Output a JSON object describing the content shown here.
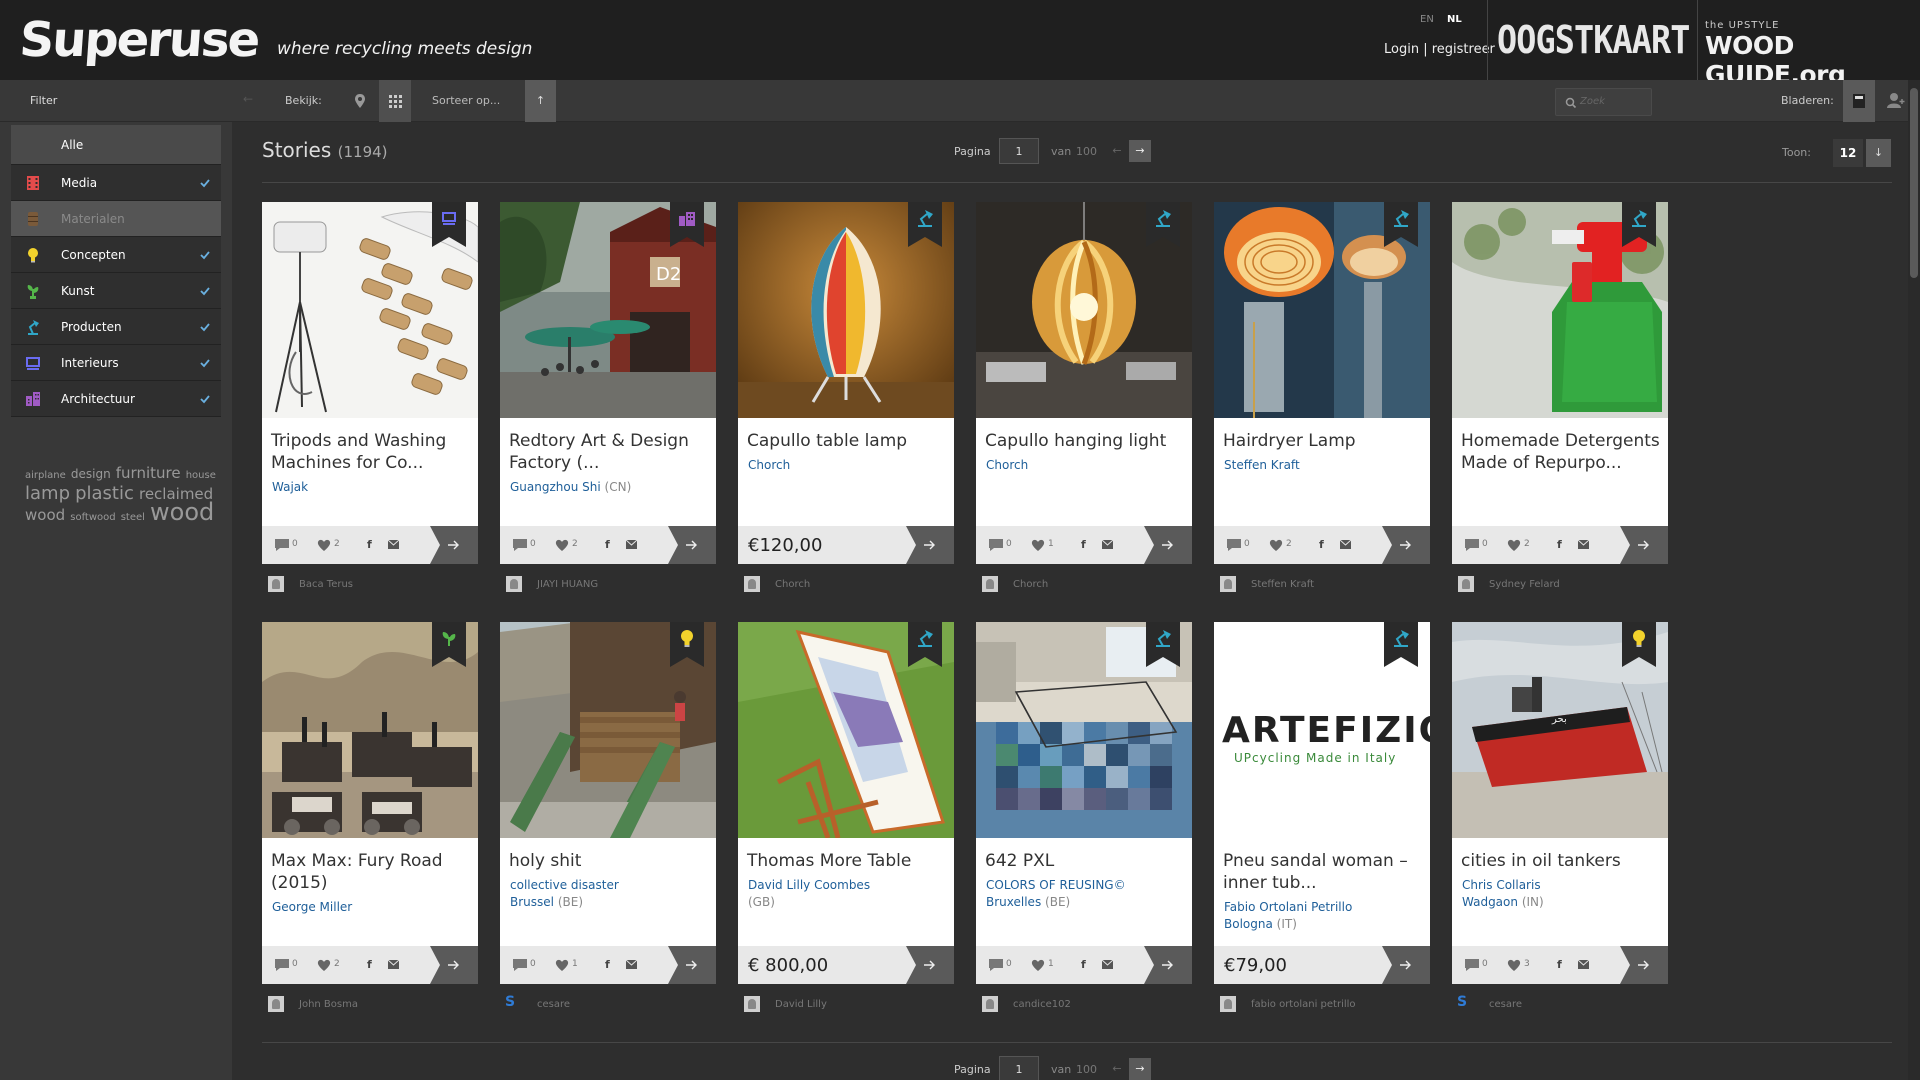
{
  "header": {
    "logo_text": "Superuse",
    "tagline": "where recycling meets design",
    "lang_en": "EN",
    "lang_nl": "NL",
    "login": "Login | registreer",
    "partner1": "OOGSTKAART",
    "partner2_small": "the UPSTYLE",
    "partner2": "WOOD GUIDE.org"
  },
  "toolbar": {
    "filter": "Filter",
    "bekijk": "Bekijk:",
    "sort": "Sorteer op...",
    "search_placeholder": "Zoek",
    "bladeren": "Bladeren:"
  },
  "sidebar": {
    "categories": [
      {
        "label": "Alle",
        "icon": "all",
        "color": "#ffffff",
        "checked": false
      },
      {
        "label": "Media",
        "icon": "film-icon",
        "color": "#e34b4b",
        "checked": true
      },
      {
        "label": "Materialen",
        "icon": "barrel-icon",
        "color": "#7a5a3a",
        "checked": false
      },
      {
        "label": "Concepten",
        "icon": "lightbulb-icon",
        "color": "#f2d22c",
        "checked": true
      },
      {
        "label": "Kunst",
        "icon": "plant-icon",
        "color": "#55b64a",
        "checked": true
      },
      {
        "label": "Producten",
        "icon": "lamp-icon",
        "color": "#30a7c8",
        "checked": true
      },
      {
        "label": "Interieurs",
        "icon": "interior-icon",
        "color": "#6a6cf2",
        "checked": true
      },
      {
        "label": "Architectuur",
        "icon": "building-icon",
        "color": "#a05bc4",
        "checked": true
      }
    ],
    "tags": [
      {
        "t": "airplane",
        "s": "sm"
      },
      {
        "t": "design",
        "s": "md"
      },
      {
        "t": "furniture",
        "s": "lg"
      },
      {
        "t": "house",
        "s": "sm"
      },
      {
        "t": "lamp",
        "s": "xl"
      },
      {
        "t": "plastic",
        "s": "xl"
      },
      {
        "t": "reclaimed",
        "s": "lg"
      },
      {
        "t": "wood",
        "s": "lg"
      },
      {
        "t": "softwood",
        "s": "sm"
      },
      {
        "t": "steel",
        "s": "sm"
      },
      {
        "t": "wood",
        "s": "xxl"
      }
    ]
  },
  "main": {
    "title": "Stories",
    "count": "(1194)",
    "pager": {
      "label": "Pagina",
      "page": "1",
      "van": "van",
      "total": "100"
    },
    "toon_label": "Toon:",
    "toon_value": "12"
  },
  "cards": [
    {
      "title": "Tripods and Washing Machines for Co...",
      "author": "Wajak",
      "loc": "",
      "cc": "",
      "comments": "0",
      "likes": "2",
      "price": "",
      "user": "Baca Terus",
      "avatar": "box",
      "ribbon": "interior",
      "img": "tripod"
    },
    {
      "title": "Redtory Art & Design Factory (...",
      "author": "",
      "loc": "Guangzhou Shi",
      "cc": "(CN)",
      "comments": "0",
      "likes": "2",
      "price": "",
      "user": "JIAYI HUANG",
      "avatar": "box",
      "ribbon": "building",
      "img": "factory"
    },
    {
      "title": "Capullo table lamp",
      "author": "Chorch",
      "loc": "",
      "cc": "",
      "comments": "",
      "likes": "",
      "price": "€120,00",
      "user": "Chorch",
      "avatar": "box",
      "ribbon": "lamp",
      "img": "tablelamp"
    },
    {
      "title": "Capullo hanging light",
      "author": "Chorch",
      "loc": "",
      "cc": "",
      "comments": "0",
      "likes": "1",
      "price": "",
      "user": "Chorch",
      "avatar": "box",
      "ribbon": "lamp",
      "img": "hanging"
    },
    {
      "title": "Hairdryer Lamp",
      "author": "Steffen Kraft",
      "loc": "",
      "cc": "",
      "comments": "0",
      "likes": "2",
      "price": "",
      "user": "Steffen Kraft",
      "avatar": "box",
      "ribbon": "lamp",
      "img": "hairdryer"
    },
    {
      "title": "Homemade Detergents Made of Repurpo...",
      "author": "",
      "loc": "",
      "cc": "",
      "comments": "0",
      "likes": "2",
      "price": "",
      "user": "Sydney Felard",
      "avatar": "box",
      "ribbon": "lamp",
      "img": "spray"
    },
    {
      "title": "Max Max: Fury Road (2015)",
      "author": "George Miller",
      "loc": "",
      "cc": "",
      "comments": "0",
      "likes": "2",
      "price": "",
      "user": "John Bosma",
      "avatar": "box",
      "ribbon": "plant",
      "img": "madmax"
    },
    {
      "title": "holy shit",
      "author": "collective disaster",
      "loc": "Brussel",
      "cc": "(BE)",
      "comments": "0",
      "likes": "1",
      "price": "",
      "user": "cesare",
      "avatar": "s",
      "ribbon": "bulb",
      "img": "slide"
    },
    {
      "title": "Thomas More Table",
      "author": "David Lilly Coombes",
      "loc": "",
      "cc": "(GB)",
      "comments": "",
      "likes": "",
      "price": "€ 800,00",
      "user": "David Lilly",
      "avatar": "box",
      "ribbon": "lamp",
      "img": "table"
    },
    {
      "title": "642 PXL",
      "author": "COLORS OF REUSING©",
      "loc": "Bruxelles",
      "cc": "(BE)",
      "comments": "0",
      "likes": "1",
      "price": "",
      "user": "candice102",
      "avatar": "box",
      "ribbon": "lamp",
      "img": "rug"
    },
    {
      "title": "Pneu sandal woman – inner tub...",
      "author": "Fabio Ortolani Petrillo",
      "loc": "Bologna",
      "cc": "(IT)",
      "comments": "",
      "likes": "",
      "price": "€79,00",
      "user": "fabio ortolani petrillo",
      "avatar": "box",
      "ribbon": "lamp",
      "img": "artefizio"
    },
    {
      "title": "cities in oil tankers",
      "author": "Chris Collaris",
      "loc": "Wadgaon",
      "cc": "(IN)",
      "comments": "0",
      "likes": "3",
      "price": "",
      "user": "cesare",
      "avatar": "s",
      "ribbon": "bulb",
      "img": "tanker"
    }
  ],
  "artefizio": {
    "brand": "ARTEFIZIO",
    "line": "UPcycling Made in Italy"
  },
  "ship_text": "بحر"
}
